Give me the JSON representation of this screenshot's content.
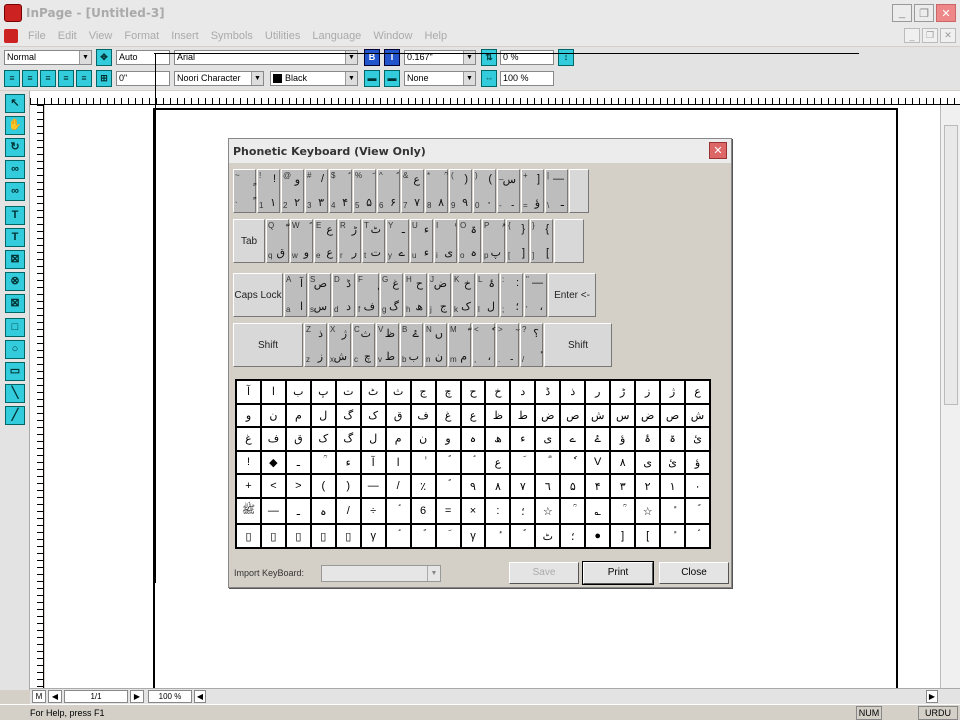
{
  "window": {
    "title": "InPage - [Untitled-3]",
    "controls": [
      "_",
      "❐",
      "✕"
    ]
  },
  "menu": {
    "items": [
      "File",
      "Edit",
      "View",
      "Format",
      "Insert",
      "Symbols",
      "Utilities",
      "Language",
      "Window",
      "Help"
    ],
    "mdi_controls": [
      "_",
      "❐",
      "✕"
    ]
  },
  "toolbar": {
    "style": "Normal",
    "leading": "Auto",
    "font": "Arial",
    "bold": "B",
    "italic": "I",
    "indent": "0.167\"",
    "tracking": "0 %",
    "left_indent": "0\"",
    "char_style": "Noori Character",
    "color": "Black",
    "underline": "None",
    "scale": "100 %"
  },
  "toolbox": {
    "tools": [
      "pointer",
      "hand",
      "rotate",
      "link",
      "unlink",
      "text",
      "text-frame",
      "picture-box",
      "oval-box",
      "polygon-box",
      "rectangle",
      "ellipse",
      "polygon",
      "line",
      "diagonal"
    ]
  },
  "workspace": {
    "page_number": "1/1",
    "zoom": "100 %",
    "master": "M"
  },
  "status": {
    "help": "For Help, press F1",
    "num": "NUM",
    "lang": "URDU"
  },
  "dialog": {
    "title": "Phonetic Keyboard (View Only)",
    "import_label": "Import KeyBoard:",
    "buttons": {
      "save": "Save",
      "print": "Print",
      "close": "Close"
    },
    "mod_keys": {
      "tab": "Tab",
      "caps": "Caps Lock",
      "enter": "Enter <-",
      "shift": "Shift"
    },
    "rows": [
      {
        "keys": [
          {
            "up": "~",
            "lo": "`",
            "g1": "ٍ",
            "g2": "ً"
          },
          {
            "up": "!",
            "lo": "1",
            "g1": "!",
            "g2": "۱"
          },
          {
            "up": "@",
            "lo": "2",
            "g1": "و",
            "g2": "۲"
          },
          {
            "up": "#",
            "lo": "3",
            "g1": "/",
            "g2": "۳"
          },
          {
            "up": "$",
            "lo": "4",
            "g1": "ؑ",
            "g2": "۴"
          },
          {
            "up": "%",
            "lo": "5",
            "g1": "ؔ",
            "g2": "۵"
          },
          {
            "up": "^",
            "lo": "6",
            "g1": "ؐ",
            "g2": "۶"
          },
          {
            "up": "&",
            "lo": "7",
            "g1": "ع",
            "g2": "۷"
          },
          {
            "up": "*",
            "lo": "8",
            "g1": "ؒ",
            "g2": "۸"
          },
          {
            "up": "(",
            "lo": "9",
            "g1": ")",
            "g2": "۹"
          },
          {
            "up": ")",
            "lo": "0",
            "g1": "(",
            "g2": "۰"
          },
          {
            "up": "_",
            "lo": "-",
            "g1": "س",
            "g2": "۔"
          },
          {
            "up": "+",
            "lo": "=",
            "g1": "]",
            "g2": "ؤ"
          },
          {
            "up": "|",
            "lo": "\\",
            "g1": "—",
            "g2": "ـ"
          }
        ]
      },
      {
        "keys": [
          {
            "up": "Q",
            "lo": "q",
            "g1": "ّ",
            "g2": "ق"
          },
          {
            "up": "W",
            "lo": "w",
            "g1": "ؐ",
            "g2": "و"
          },
          {
            "up": "E",
            "lo": "e",
            "g1": "ع",
            "g2": "ع"
          },
          {
            "up": "R",
            "lo": "r",
            "g1": "ڑ",
            "g2": "ر"
          },
          {
            "up": "T",
            "lo": "t",
            "g1": "ٹ",
            "g2": "ت"
          },
          {
            "up": "Y",
            "lo": "y",
            "g1": "ـ",
            "g2": "ے"
          },
          {
            "up": "U",
            "lo": "u",
            "g1": "ء",
            "g2": "ء"
          },
          {
            "up": "I",
            "lo": "i",
            "g1": "ٰ",
            "g2": "ی"
          },
          {
            "up": "O",
            "lo": "o",
            "g1": "ۃ",
            "g2": "ہ"
          },
          {
            "up": "P",
            "lo": "p",
            "g1": "ُ",
            "g2": "پ"
          },
          {
            "up": "{",
            "lo": "[",
            "g1": "}",
            "g2": "]"
          },
          {
            "up": "}",
            "lo": "]",
            "g1": "{",
            "g2": "["
          }
        ]
      },
      {
        "keys": [
          {
            "up": "A",
            "lo": "a",
            "g1": "آ",
            "g2": "ا"
          },
          {
            "up": "S",
            "lo": "s",
            "g1": "ص",
            "g2": "س"
          },
          {
            "up": "D",
            "lo": "d",
            "g1": "ڈ",
            "g2": "د"
          },
          {
            "up": "F",
            "lo": "f",
            "g1": "ٖ",
            "g2": "ف"
          },
          {
            "up": "G",
            "lo": "g",
            "g1": "غ",
            "g2": "گ"
          },
          {
            "up": "H",
            "lo": "h",
            "g1": "ح",
            "g2": "ھ"
          },
          {
            "up": "J",
            "lo": "j",
            "g1": "ض",
            "g2": "ج"
          },
          {
            "up": "K",
            "lo": "k",
            "g1": "خ",
            "g2": "ک"
          },
          {
            "up": "L",
            "lo": "l",
            "g1": "ۂ",
            "g2": "ل"
          },
          {
            "up": ":",
            "lo": ";",
            "g1": ":",
            "g2": "؛"
          },
          {
            "up": "\"",
            "lo": "'",
            "g1": "—",
            "g2": "،"
          }
        ]
      },
      {
        "keys": [
          {
            "up": "Z",
            "lo": "z",
            "g1": "ذ",
            "g2": "ز"
          },
          {
            "up": "X",
            "lo": "x",
            "g1": "ژ",
            "g2": "ش"
          },
          {
            "up": "C",
            "lo": "c",
            "g1": "ث",
            "g2": "چ"
          },
          {
            "up": "V",
            "lo": "v",
            "g1": "ظ",
            "g2": "ط"
          },
          {
            "up": "B",
            "lo": "b",
            "g1": "ۓ",
            "g2": "ب"
          },
          {
            "up": "N",
            "lo": "n",
            "g1": "ں",
            "g2": "ن"
          },
          {
            "up": "M",
            "lo": "m",
            "g1": "ّ",
            "g2": "م"
          },
          {
            "up": "<",
            "lo": ",",
            "g1": "ٗ",
            "g2": "،"
          },
          {
            "up": ">",
            "lo": ".",
            "g1": "ٓ",
            "g2": "۔"
          },
          {
            "up": "?",
            "lo": "/",
            "g1": "؟",
            "g2": "ٔ"
          }
        ]
      }
    ],
    "symbols": [
      "آ",
      "ا",
      "ب",
      "پ",
      "ت",
      "ٹ",
      "ث",
      "ج",
      "چ",
      "ح",
      "خ",
      "د",
      "ڈ",
      "ذ",
      "ر",
      "ڑ",
      "ز",
      "ژ",
      "ع",
      "و",
      "ن",
      "م",
      "ل",
      "گ",
      "ک",
      "ق",
      "ف",
      "غ",
      "ع",
      "ظ",
      "ط",
      "ض",
      "ص",
      "ش",
      "س",
      "ض",
      "ص",
      "ش",
      "غ",
      "ف",
      "ق",
      "ک",
      "گ",
      "ل",
      "م",
      "ن",
      "و",
      "ہ",
      "ھ",
      "ء",
      "ی",
      "ے",
      "ۓ",
      "ؤ",
      "ۂ",
      "ۃ",
      "ئ",
      "!",
      "◆",
      "ـ",
      "ؒ",
      "ء",
      "آ",
      "ا",
      "ٰ",
      "ؐ",
      "ؑ",
      "ع",
      "ؔ",
      "ؓ",
      "ٗ",
      "V",
      "٨",
      "ی",
      "ئ",
      "ؤ",
      "+",
      "<",
      ">",
      "(",
      ")",
      "—",
      "/",
      "٪",
      "ؐ",
      "۹",
      "۸",
      "۷",
      "٦",
      "۵",
      "۴",
      "۳",
      "۲",
      "۱",
      "۰",
      "ﷺ",
      "—",
      "ـ",
      "ہ",
      "/",
      "÷",
      "ؑ",
      "6",
      "=",
      "×",
      ":",
      "؛",
      "☆",
      "ؒ",
      "؎",
      "ؒ",
      "☆",
      "ٔ",
      "ؐ",
      "▯",
      "▯",
      "▯",
      "▯",
      "▯",
      "γ",
      "ؑ",
      "ؐ",
      "ؔ",
      "γ",
      "ٔ",
      "ؐ",
      "ٹ",
      "؛",
      "●",
      "]",
      "[",
      "ٔ",
      "ؑ"
    ]
  }
}
